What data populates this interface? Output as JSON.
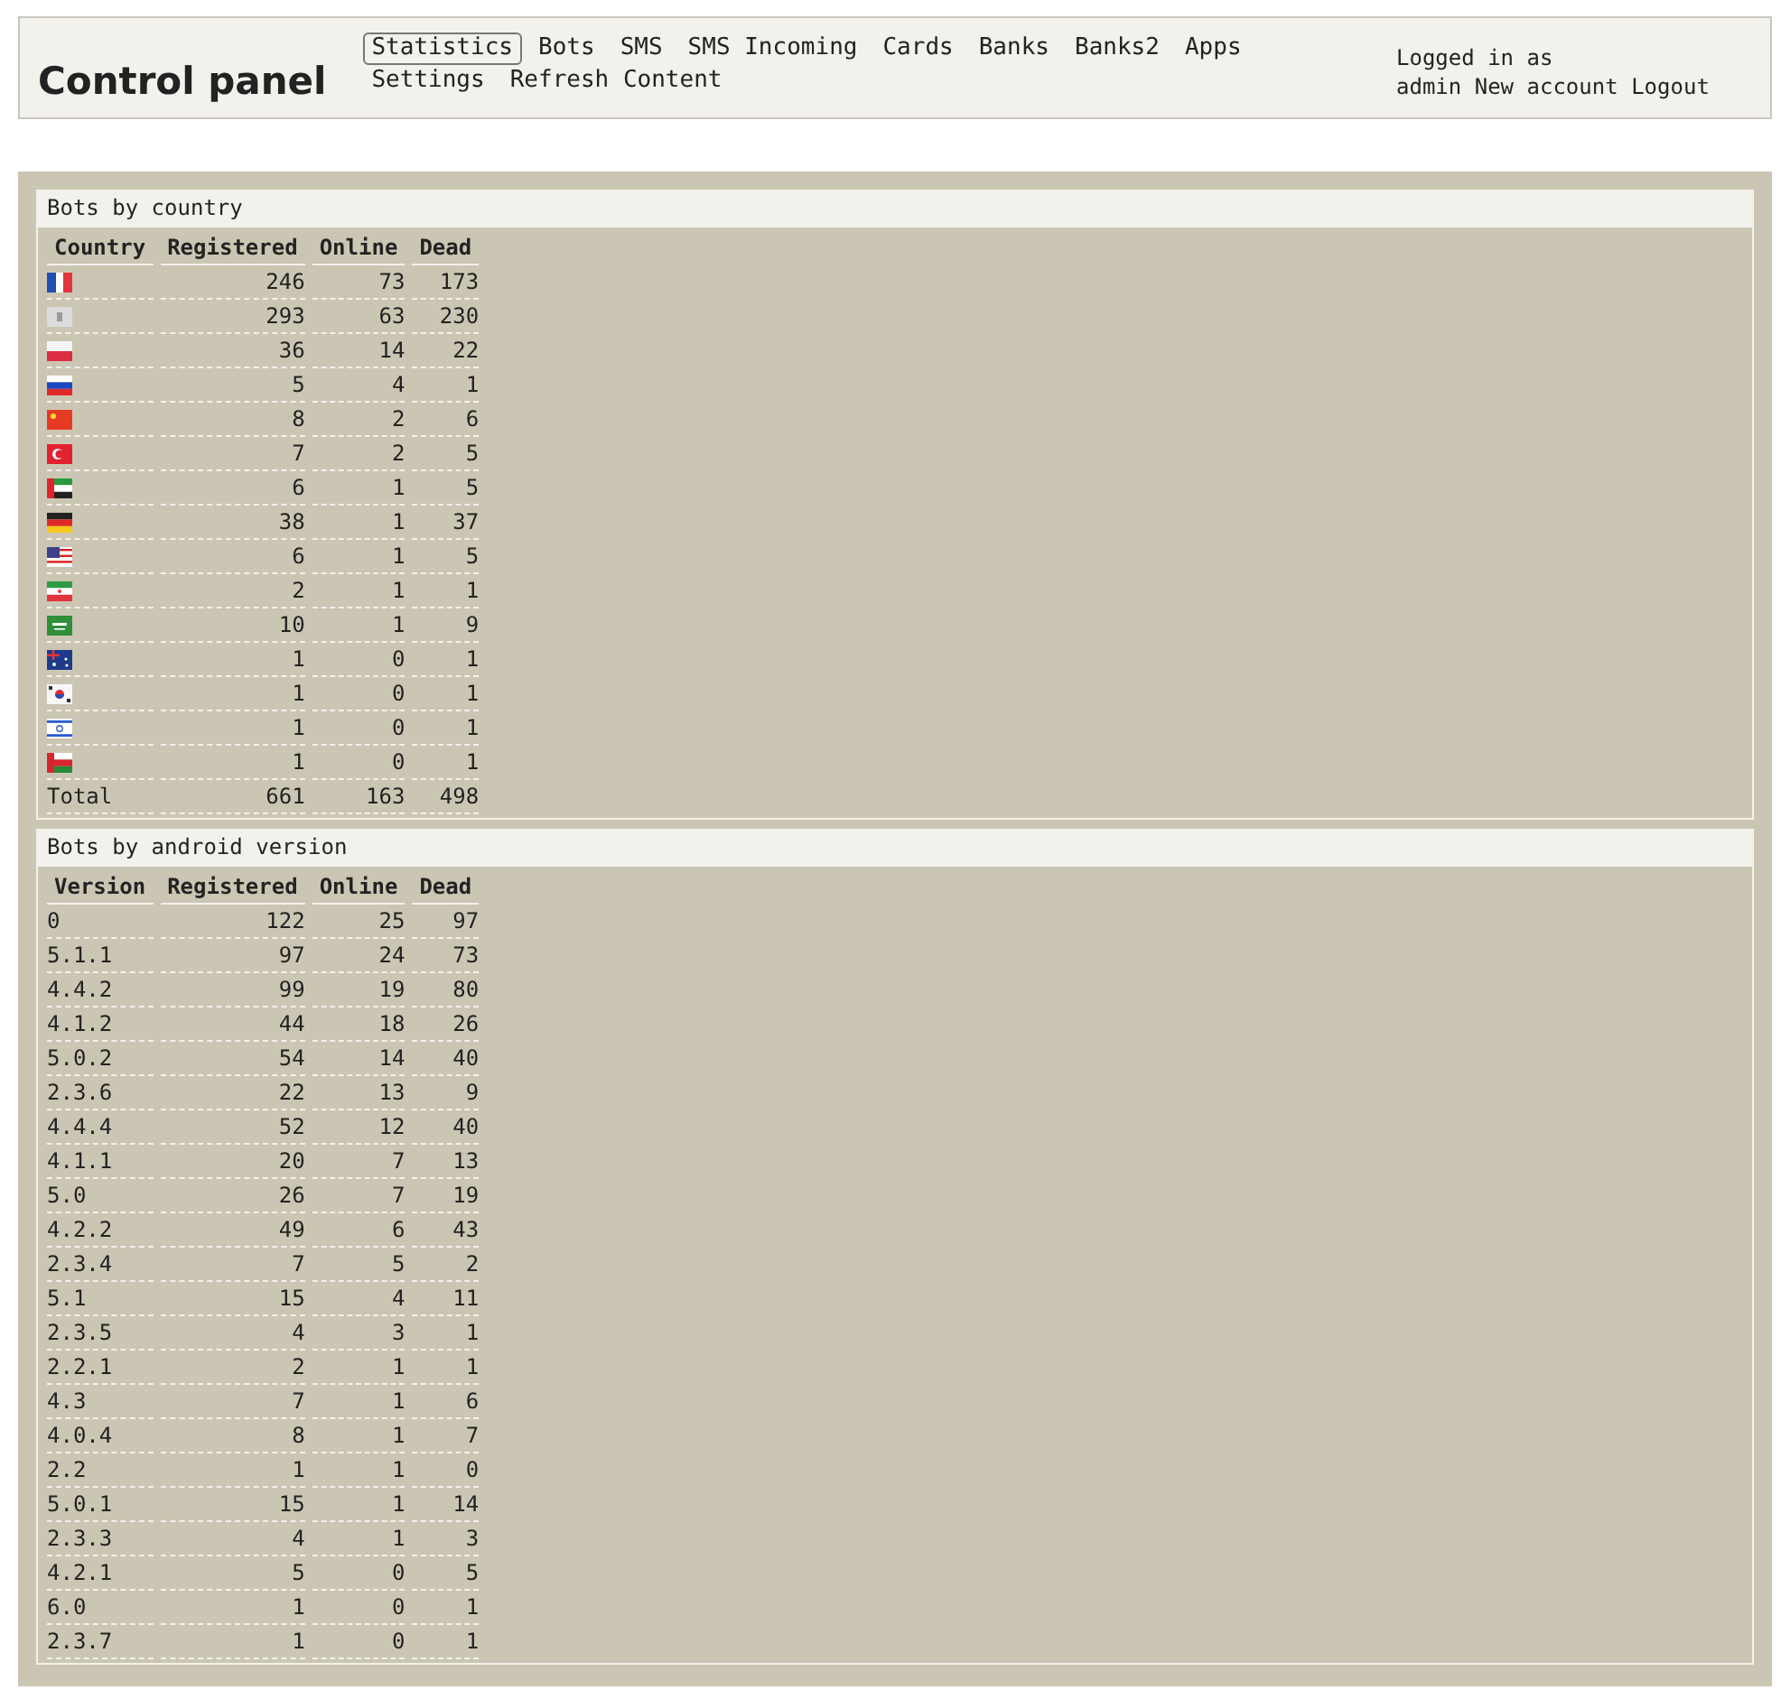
{
  "header": {
    "title": "Control panel",
    "nav": [
      {
        "label": "Statistics",
        "selected": true
      },
      {
        "label": "Bots",
        "selected": false
      },
      {
        "label": "SMS",
        "selected": false
      },
      {
        "label": "SMS Incoming",
        "selected": false
      },
      {
        "label": "Cards",
        "selected": false
      },
      {
        "label": "Banks",
        "selected": false
      },
      {
        "label": "Banks2",
        "selected": false
      },
      {
        "label": "Apps",
        "selected": false
      },
      {
        "label": "Settings",
        "selected": false
      },
      {
        "label": "Refresh Content",
        "selected": false
      }
    ],
    "user": {
      "status": "Logged in as",
      "name": "admin",
      "links": [
        "New account",
        "Logout"
      ]
    }
  },
  "sections": [
    {
      "title": "Bots by country",
      "columns": [
        "Country",
        "Registered",
        "Online",
        "Dead"
      ],
      "rows": [
        {
          "kind": "fr",
          "cells": [
            "246",
            "73",
            "173"
          ]
        },
        {
          "kind": "unknown",
          "cells": [
            "293",
            "63",
            "230"
          ]
        },
        {
          "kind": "pl",
          "cells": [
            "36",
            "14",
            "22"
          ]
        },
        {
          "kind": "ru",
          "cells": [
            "5",
            "4",
            "1"
          ]
        },
        {
          "kind": "cn",
          "cells": [
            "8",
            "2",
            "6"
          ]
        },
        {
          "kind": "tr",
          "cells": [
            "7",
            "2",
            "5"
          ]
        },
        {
          "kind": "ae",
          "cells": [
            "6",
            "1",
            "5"
          ]
        },
        {
          "kind": "de",
          "cells": [
            "38",
            "1",
            "37"
          ]
        },
        {
          "kind": "us",
          "cells": [
            "6",
            "1",
            "5"
          ]
        },
        {
          "kind": "ir",
          "cells": [
            "2",
            "1",
            "1"
          ]
        },
        {
          "kind": "sa",
          "cells": [
            "10",
            "1",
            "9"
          ]
        },
        {
          "kind": "au",
          "cells": [
            "1",
            "0",
            "1"
          ]
        },
        {
          "kind": "kr",
          "cells": [
            "1",
            "0",
            "1"
          ]
        },
        {
          "kind": "il",
          "cells": [
            "1",
            "0",
            "1"
          ]
        },
        {
          "kind": "om",
          "cells": [
            "1",
            "0",
            "1"
          ]
        },
        {
          "kind": "text",
          "cells": [
            "Total",
            "661",
            "163",
            "498"
          ]
        }
      ]
    },
    {
      "title": "Bots by android version",
      "columns": [
        "Version",
        "Registered",
        "Online",
        "Dead"
      ],
      "rows": [
        {
          "kind": "text",
          "cells": [
            "0",
            "122",
            "25",
            "97"
          ]
        },
        {
          "kind": "text",
          "cells": [
            "5.1.1",
            "97",
            "24",
            "73"
          ]
        },
        {
          "kind": "text",
          "cells": [
            "4.4.2",
            "99",
            "19",
            "80"
          ]
        },
        {
          "kind": "text",
          "cells": [
            "4.1.2",
            "44",
            "18",
            "26"
          ]
        },
        {
          "kind": "text",
          "cells": [
            "5.0.2",
            "54",
            "14",
            "40"
          ]
        },
        {
          "kind": "text",
          "cells": [
            "2.3.6",
            "22",
            "13",
            "9"
          ]
        },
        {
          "kind": "text",
          "cells": [
            "4.4.4",
            "52",
            "12",
            "40"
          ]
        },
        {
          "kind": "text",
          "cells": [
            "4.1.1",
            "20",
            "7",
            "13"
          ]
        },
        {
          "kind": "text",
          "cells": [
            "5.0",
            "26",
            "7",
            "19"
          ]
        },
        {
          "kind": "text",
          "cells": [
            "4.2.2",
            "49",
            "6",
            "43"
          ]
        },
        {
          "kind": "text",
          "cells": [
            "2.3.4",
            "7",
            "5",
            "2"
          ]
        },
        {
          "kind": "text",
          "cells": [
            "5.1",
            "15",
            "4",
            "11"
          ]
        },
        {
          "kind": "text",
          "cells": [
            "2.3.5",
            "4",
            "3",
            "1"
          ]
        },
        {
          "kind": "text",
          "cells": [
            "2.2.1",
            "2",
            "1",
            "1"
          ]
        },
        {
          "kind": "text",
          "cells": [
            "4.3",
            "7",
            "1",
            "6"
          ]
        },
        {
          "kind": "text",
          "cells": [
            "4.0.4",
            "8",
            "1",
            "7"
          ]
        },
        {
          "kind": "text",
          "cells": [
            "2.2",
            "1",
            "1",
            "0"
          ]
        },
        {
          "kind": "text",
          "cells": [
            "5.0.1",
            "15",
            "1",
            "14"
          ]
        },
        {
          "kind": "text",
          "cells": [
            "2.3.3",
            "4",
            "1",
            "3"
          ]
        },
        {
          "kind": "text",
          "cells": [
            "4.2.1",
            "5",
            "0",
            "5"
          ]
        },
        {
          "kind": "text",
          "cells": [
            "6.0",
            "1",
            "0",
            "1"
          ]
        },
        {
          "kind": "text",
          "cells": [
            "2.3.7",
            "1",
            "0",
            "1"
          ]
        }
      ]
    }
  ]
}
